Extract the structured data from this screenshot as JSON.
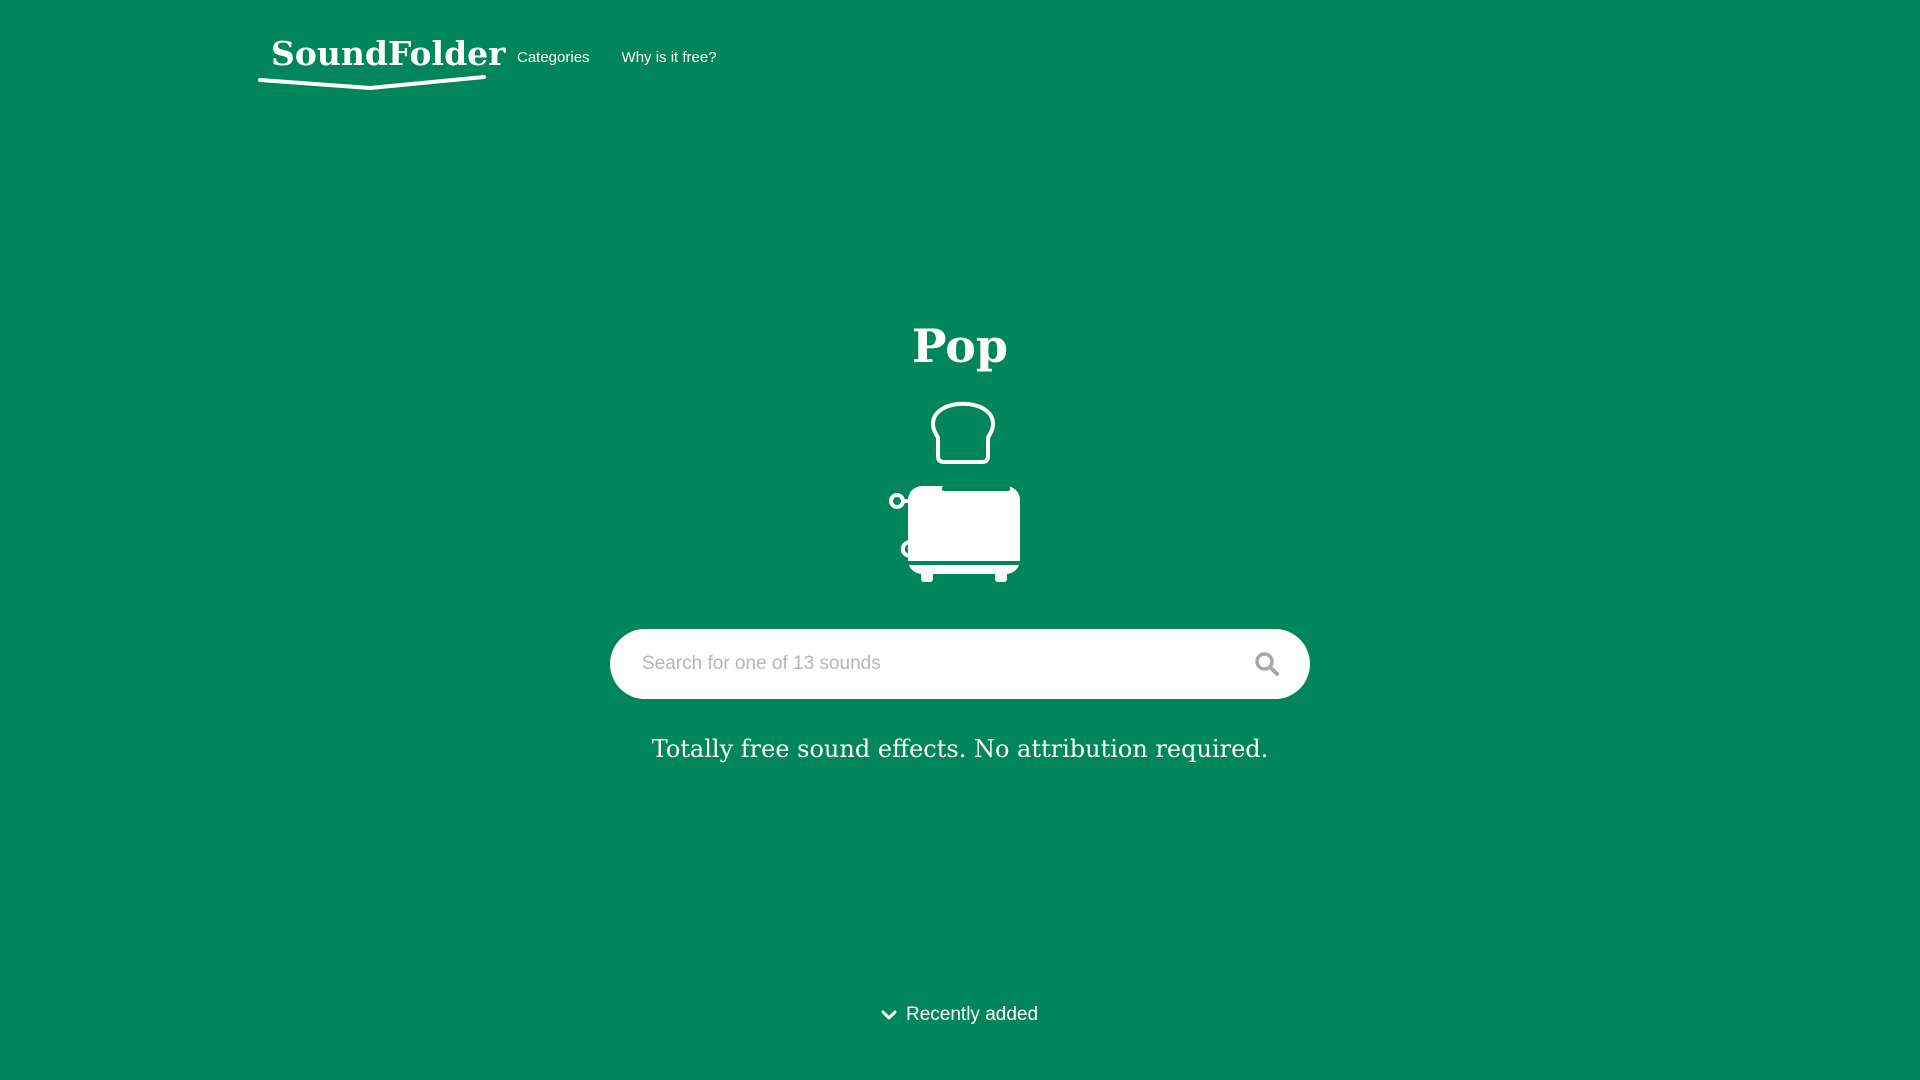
{
  "brand": {
    "name": "SoundFolder"
  },
  "nav": {
    "items": [
      {
        "label": "Categories"
      },
      {
        "label": "Why is it free?"
      }
    ]
  },
  "hero": {
    "title": "Pop",
    "illustration": "toaster-with-bread-icon"
  },
  "search": {
    "placeholder": "Search for one of 13 sounds",
    "value": "",
    "icon": "search-icon"
  },
  "tagline": "Totally free sound effects. No attribution required.",
  "recent": {
    "label": "Recently added",
    "icon": "chevron-down-icon"
  },
  "colors": {
    "background": "#00865a",
    "text": "#ffffff",
    "search_background": "#ffffff",
    "placeholder": "#b5b5b5",
    "search_icon": "#a8a8a8"
  }
}
